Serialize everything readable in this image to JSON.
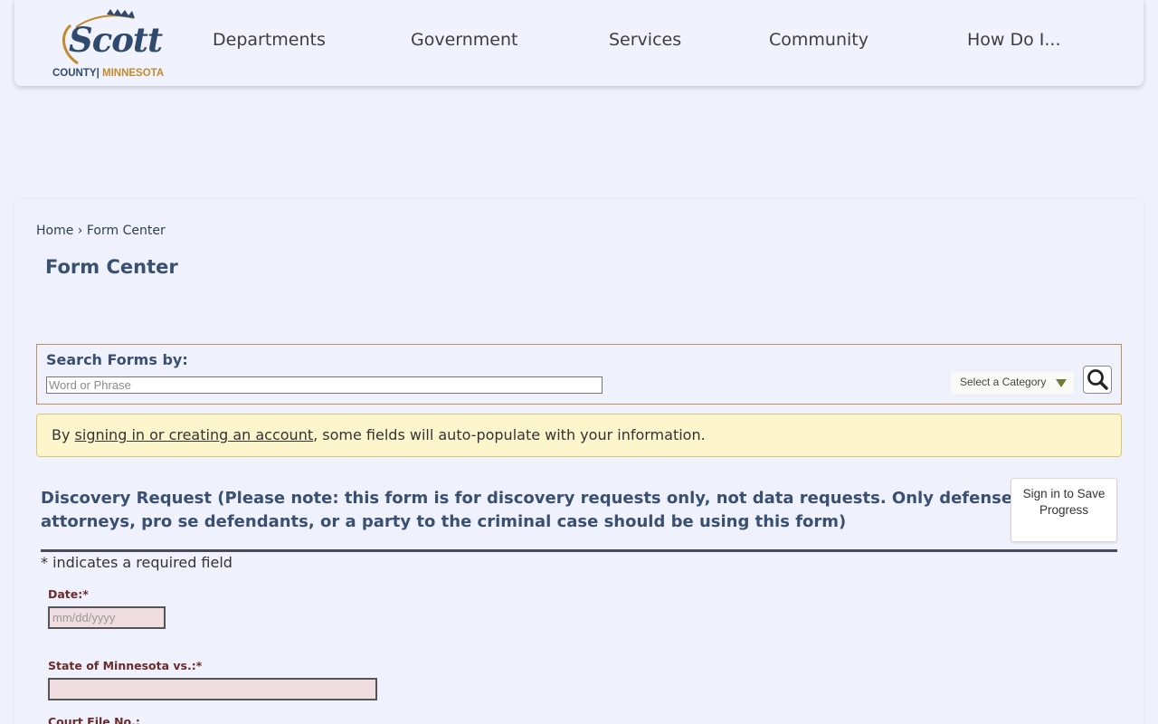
{
  "header": {
    "logo": {
      "name": "Scott",
      "county": "COUNTY",
      "separator": "|",
      "state": "MINNESOTA"
    },
    "nav": [
      "Departments",
      "Government",
      "Services",
      "Community",
      "How Do I..."
    ]
  },
  "breadcrumb": {
    "home": "Home",
    "separator": "›",
    "current": "Form Center"
  },
  "page_title": "Form Center",
  "search": {
    "label": "Search Forms by:",
    "placeholder": "Word or Phrase",
    "category_label": "Select a Category"
  },
  "notice": {
    "prefix": "By ",
    "link": "signing in or creating an account",
    "suffix": ", some fields will auto-populate with your information."
  },
  "form": {
    "title": "Discovery Request (Please note: this form is for discovery requests only, not data requests. Only defense attorneys, pro se defendants, or a party to the criminal case should be using this form)",
    "save_button": "Sign in to Save Progress",
    "required_note": "* indicates a required field",
    "fields": [
      {
        "label": "Date:*",
        "placeholder": "mm/dd/yyyy"
      },
      {
        "label": "State of Minnesota vs.:*",
        "placeholder": ""
      },
      {
        "label": "Court File No.:",
        "placeholder": ""
      }
    ]
  },
  "colors": {
    "background": "#eff2fd",
    "heading": "#3a5070",
    "field_label": "#6b2b2b",
    "field_bg": "#f0dde0",
    "notice_bg": "#fdf6cc",
    "logo_gold": "#c38a2f"
  }
}
